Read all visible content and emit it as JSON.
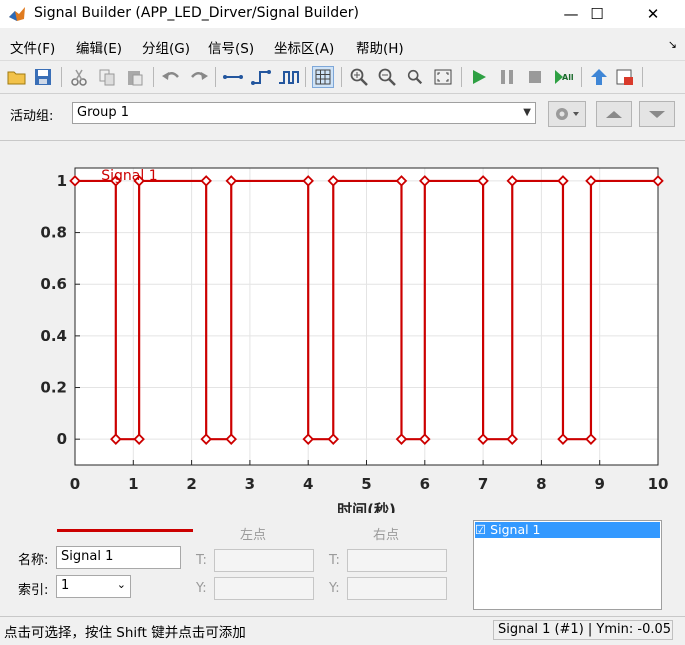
{
  "window": {
    "title": "Signal Builder (APP_LED_Dirver/Signal Builder)",
    "minimize_glyph": "—",
    "maximize_glyph": "☐",
    "close_glyph": "✕"
  },
  "menu": {
    "items": [
      "文件(F)",
      "编辑(E)",
      "分组(G)",
      "信号(S)",
      "坐标区(A)",
      "帮助(H)"
    ],
    "overflow_glyph": "↘"
  },
  "toolbar": {
    "icons": [
      "open-folder-icon",
      "save-icon",
      "cut-icon",
      "copy-icon",
      "paste-icon",
      "undo-icon",
      "redo-icon",
      "constant-signal-icon",
      "step-signal-icon",
      "pulse-signal-icon",
      "grid-icon",
      "zoom-in-xy-icon",
      "zoom-in-x-icon",
      "zoom-in-y-icon",
      "fit-view-icon",
      "run-icon",
      "pause-icon",
      "stop-icon",
      "run-all-icon",
      "up-arrow-icon",
      "simulink-block-icon"
    ]
  },
  "group_bar": {
    "label": "活动组:",
    "selected": "Group 1"
  },
  "chart_data": {
    "type": "line",
    "xlabel": "时间(秒)",
    "xlim": [
      0,
      10
    ],
    "ylim": [
      -0.1,
      1.05
    ],
    "xticks": [
      0,
      1,
      2,
      3,
      4,
      5,
      6,
      7,
      8,
      9,
      10
    ],
    "yticks": [
      0,
      0.2,
      0.4,
      0.6,
      0.8,
      1
    ],
    "xtick_labels": [
      "0",
      "1",
      "2",
      "3",
      "4",
      "5",
      "6",
      "7",
      "8",
      "9",
      "10"
    ],
    "ytick_labels": [
      "0",
      "0.2",
      "0.4",
      "0.6",
      "0.8",
      "1"
    ],
    "grid": true,
    "color": "#cc0000",
    "series": [
      {
        "name": "Signal 1",
        "x": [
          0,
          0.7,
          0.7,
          1.1,
          1.1,
          2.25,
          2.25,
          2.68,
          2.68,
          4.0,
          4.0,
          4.43,
          4.43,
          5.6,
          5.6,
          6.0,
          6.0,
          7.0,
          7.0,
          7.5,
          7.5,
          8.37,
          8.37,
          8.85,
          8.85,
          10
        ],
        "y": [
          1,
          1,
          0,
          0,
          1,
          1,
          0,
          0,
          1,
          1,
          0,
          0,
          1,
          1,
          0,
          0,
          1,
          1,
          0,
          0,
          1,
          1,
          0,
          0,
          1,
          1
        ]
      }
    ],
    "signal_label": "Signal 1"
  },
  "editor": {
    "left_point_header": "左点",
    "right_point_header": "右点",
    "name_label": "名称:",
    "name_value": "Signal 1",
    "index_label": "索引:",
    "index_value": "1",
    "t_label": "T:",
    "y_label": "Y:"
  },
  "signal_list": {
    "items": [
      "☑ Signal 1"
    ]
  },
  "status": {
    "left": "点击可选择，按住 Shift 键并点击可添加",
    "right": "Signal 1 (#1) | Ymin: -0.05"
  }
}
